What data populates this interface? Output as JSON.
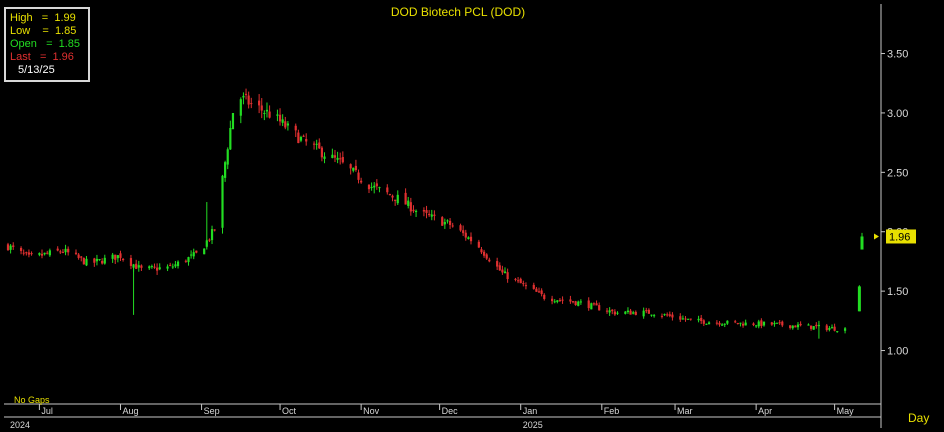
{
  "chart_data": {
    "type": "candlestick",
    "title": "DOD Biotech PCL (DOD)",
    "period": "Day",
    "note": "No Gaps",
    "info_box": {
      "high": "High   =  1.99",
      "low": "Low    =  1.85",
      "open": "Open   =  1.85",
      "last": "Last   =  1.96",
      "date": "5/13/25"
    },
    "last_price_label": "1.96",
    "y_axis": {
      "ticks": [
        1.0,
        1.5,
        2.0,
        2.5,
        3.0,
        3.5
      ],
      "tick_labels": [
        "1.00",
        "1.50",
        "2.00",
        "2.50",
        "3.00",
        "3.50"
      ],
      "range": [
        0.55,
        3.9
      ]
    },
    "x_axis": {
      "months": [
        "Jul",
        "Aug",
        "Sep",
        "Oct",
        "Nov",
        "Dec",
        "Jan",
        "Feb",
        "Mar",
        "Apr",
        "May"
      ],
      "years": [
        "2024",
        "2025"
      ]
    },
    "price_path": [
      {
        "date": "2024-06-19",
        "close": 1.88
      },
      {
        "date": "2024-06-27",
        "close": 1.78
      },
      {
        "date": "2024-07-10",
        "close": 1.84
      },
      {
        "date": "2024-07-20",
        "close": 1.73
      },
      {
        "date": "2024-08-01",
        "close": 1.8
      },
      {
        "date": "2024-08-09",
        "close": 1.68
      },
      {
        "date": "2024-08-20",
        "close": 1.7
      },
      {
        "date": "2024-08-31",
        "close": 1.82
      },
      {
        "date": "2024-09-06",
        "close": 2.02
      },
      {
        "date": "2024-09-14",
        "close": 3.15
      },
      {
        "date": "2024-09-22",
        "close": 3.05
      },
      {
        "date": "2024-09-28",
        "close": 2.98
      },
      {
        "date": "2024-10-10",
        "close": 2.76
      },
      {
        "date": "2024-10-24",
        "close": 2.58
      },
      {
        "date": "2024-11-05",
        "close": 2.38
      },
      {
        "date": "2024-11-15",
        "close": 2.28
      },
      {
        "date": "2024-11-24",
        "close": 2.15
      },
      {
        "date": "2024-12-05",
        "close": 2.06
      },
      {
        "date": "2024-12-15",
        "close": 1.9
      },
      {
        "date": "2024-12-25",
        "close": 1.65
      },
      {
        "date": "2025-01-10",
        "close": 1.45
      },
      {
        "date": "2025-01-24",
        "close": 1.4
      },
      {
        "date": "2025-02-06",
        "close": 1.32
      },
      {
        "date": "2025-02-20",
        "close": 1.32
      },
      {
        "date": "2025-03-08",
        "close": 1.25
      },
      {
        "date": "2025-03-24",
        "close": 1.23
      },
      {
        "date": "2025-04-08",
        "close": 1.22
      },
      {
        "date": "2025-04-22",
        "close": 1.2
      },
      {
        "date": "2025-05-05",
        "close": 1.18
      }
    ],
    "spikes": [
      {
        "date": "2024-08-06",
        "high": 1.72,
        "low": 1.3
      },
      {
        "date": "2024-09-03",
        "high": 2.25,
        "low": 1.85
      },
      {
        "date": "2025-04-25",
        "high": 1.25,
        "low": 1.1
      }
    ],
    "final_candles": [
      {
        "date": "2025-05-12",
        "open": 1.33,
        "high": 1.55,
        "low": 1.33,
        "close": 1.54
      },
      {
        "date": "2025-05-13",
        "open": 1.85,
        "high": 1.99,
        "low": 1.85,
        "close": 1.96
      }
    ]
  },
  "colors": {
    "up": "#22dd22",
    "down": "#e03030",
    "background": "#000000",
    "axis": "#c8c8c8",
    "title": "#e8e000",
    "grid_label": "#d8d8d8",
    "last_label_bg": "#e8e000"
  }
}
